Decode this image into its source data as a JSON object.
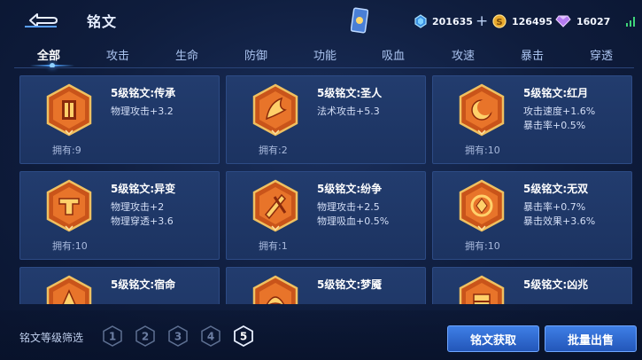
{
  "header": {
    "title": "铭文",
    "back_icon": "back-arrow-icon",
    "card_icon": "rune-card-icon",
    "currencies": [
      {
        "icon": "diamond-icon",
        "value": "201635",
        "plus": "+"
      },
      {
        "icon": "gold-coin-icon",
        "value": "126495"
      },
      {
        "icon": "gem-icon",
        "value": "16027"
      }
    ],
    "signal_icon": "wifi-signal-icon"
  },
  "tabs": [
    "全部",
    "攻击",
    "生命",
    "防御",
    "功能",
    "吸血",
    "攻速",
    "暴击",
    "穿透"
  ],
  "active_tab": "全部",
  "cards": [
    {
      "name": "5级铭文:传承",
      "attrs": [
        "物理攻击+3.2"
      ],
      "owned": "拥有:9"
    },
    {
      "name": "5级铭文:圣人",
      "attrs": [
        "法术攻击+5.3"
      ],
      "owned": "拥有:2"
    },
    {
      "name": "5级铭文:红月",
      "attrs": [
        "攻击速度+1.6%",
        "暴击率+0.5%"
      ],
      "owned": "拥有:10"
    },
    {
      "name": "5级铭文:异变",
      "attrs": [
        "物理攻击+2",
        "物理穿透+3.6"
      ],
      "owned": "拥有:10"
    },
    {
      "name": "5级铭文:纷争",
      "attrs": [
        "物理攻击+2.5",
        "物理吸血+0.5%"
      ],
      "owned": "拥有:1"
    },
    {
      "name": "5级铭文:无双",
      "attrs": [
        "暴击率+0.7%",
        "暴击效果+3.6%"
      ],
      "owned": "拥有:10"
    },
    {
      "name": "5级铭文:宿命",
      "attrs": [
        "",
        ""
      ],
      "owned": ""
    },
    {
      "name": "5级铭文:梦魇",
      "attrs": [
        "",
        ""
      ],
      "owned": ""
    },
    {
      "name": "5级铭文:凶兆",
      "attrs": [
        "",
        ""
      ],
      "owned": ""
    }
  ],
  "bottom": {
    "filter_label": "铭文等级筛选",
    "levels": [
      "1",
      "2",
      "3",
      "4",
      "5"
    ],
    "selected_level": "5",
    "obtain_button": "铭文获取",
    "bulk_sell_button": "批量出售"
  },
  "colors": {
    "background": "#0f1d3d",
    "card": "#223c6e",
    "accent": "#3f7fe6",
    "rune_orange": "#d8611e",
    "rune_gold": "#f0c060"
  }
}
